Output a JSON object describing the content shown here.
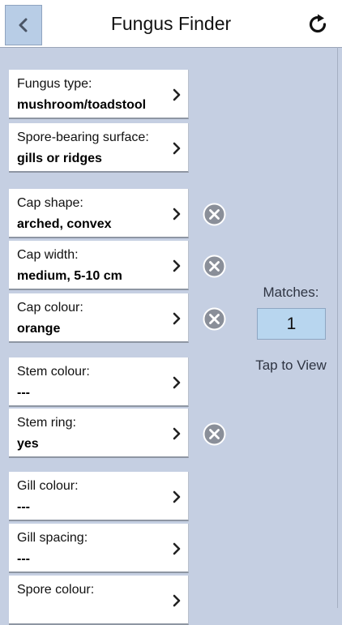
{
  "header": {
    "title": "Fungus Finder",
    "back_icon": "chevron-left-icon",
    "refresh_icon": "refresh-icon"
  },
  "criteria": [
    {
      "label": "Fungus type:",
      "value": "mushroom/toadstool",
      "clearable": false
    },
    {
      "label": "Spore-bearing surface:",
      "value": "gills or ridges",
      "clearable": false
    },
    {
      "label": "Cap shape:",
      "value": "arched, convex",
      "clearable": true
    },
    {
      "label": "Cap width:",
      "value": "medium, 5-10 cm",
      "clearable": true
    },
    {
      "label": "Cap colour:",
      "value": "orange",
      "clearable": true
    },
    {
      "label": "Stem colour:",
      "value": "---",
      "clearable": false
    },
    {
      "label": "Stem ring:",
      "value": "yes",
      "clearable": true
    },
    {
      "label": "Gill colour:",
      "value": "---",
      "clearable": false
    },
    {
      "label": "Gill spacing:",
      "value": "---",
      "clearable": false
    },
    {
      "label": "Spore colour:",
      "value": "",
      "clearable": false
    }
  ],
  "matches": {
    "label": "Matches:",
    "count": "1",
    "view_label": "Tap to View"
  },
  "colors": {
    "background": "#c5cfe2",
    "matches_box": "#b8d6ef",
    "back_button": "#b8cde6",
    "clear_icon": "#8a8f99"
  }
}
